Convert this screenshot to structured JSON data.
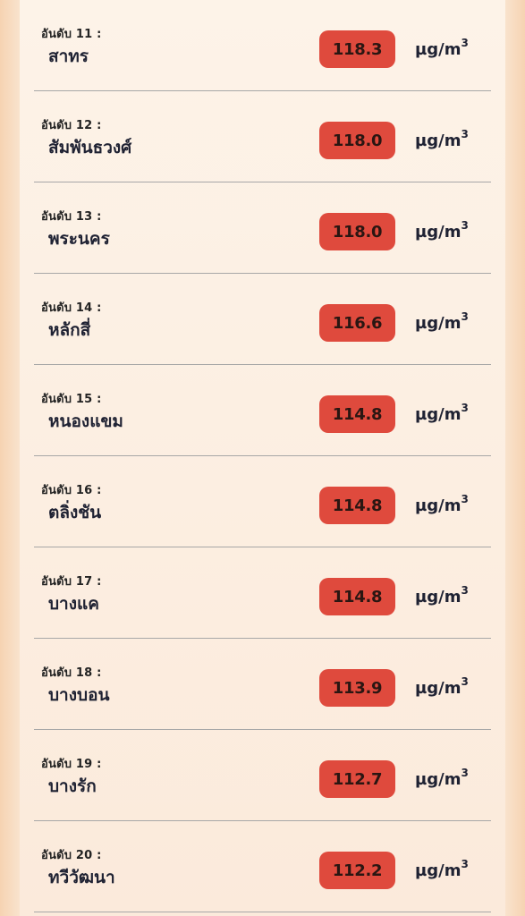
{
  "unit": {
    "base": "µg/m",
    "exponent": "3"
  },
  "rankings": [
    {
      "rank_label": "อันดับ 11 :",
      "district": "สาทร",
      "value": "118.3"
    },
    {
      "rank_label": "อันดับ 12 :",
      "district": "สัมพันธวงศ์",
      "value": "118.0"
    },
    {
      "rank_label": "อันดับ 13 :",
      "district": "พระนคร",
      "value": "118.0"
    },
    {
      "rank_label": "อันดับ 14 :",
      "district": "หลักสี่",
      "value": "116.6"
    },
    {
      "rank_label": "อันดับ 15 :",
      "district": "หนองแขม",
      "value": "114.8"
    },
    {
      "rank_label": "อันดับ 16 :",
      "district": "ตลิ่งชัน",
      "value": "114.8"
    },
    {
      "rank_label": "อันดับ 17 :",
      "district": "บางแค",
      "value": "114.8"
    },
    {
      "rank_label": "อันดับ 18 :",
      "district": "บางบอน",
      "value": "113.9"
    },
    {
      "rank_label": "อันดับ 19 :",
      "district": "บางรัก",
      "value": "112.7"
    },
    {
      "rank_label": "อันดับ 20 :",
      "district": "ทวีวัฒนา",
      "value": "112.2"
    }
  ],
  "colors": {
    "badge": "#df4a3d",
    "text": "#1f2233",
    "divider": "#a7a7a7",
    "card_bg": "#fdf3e8",
    "page_bg": "#f6d3b2"
  }
}
